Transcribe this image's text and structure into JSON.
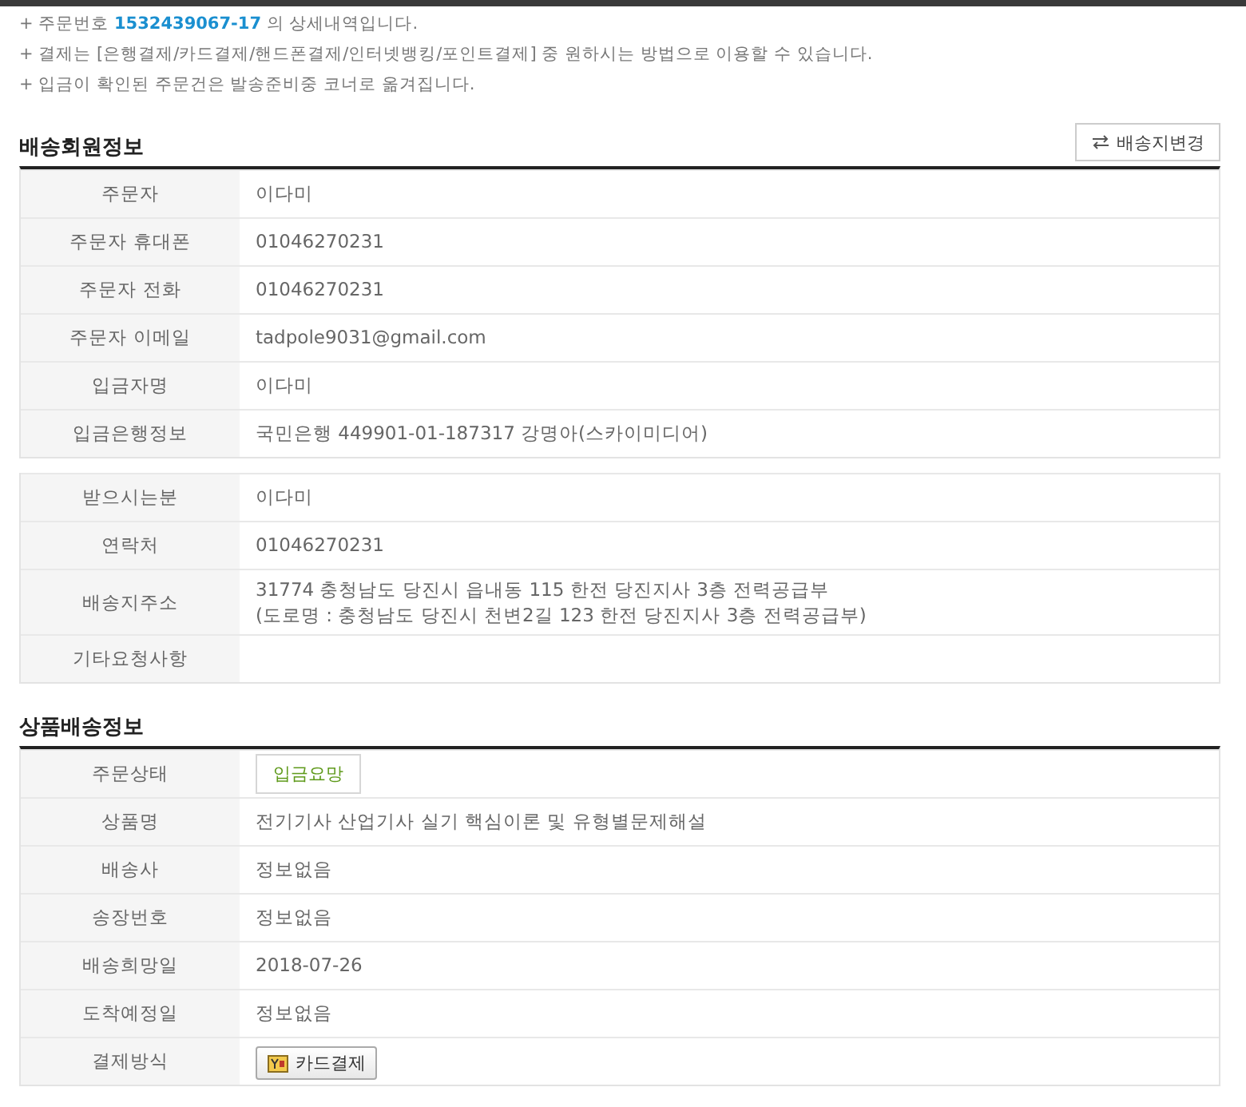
{
  "notes": [
    {
      "text": "+ 주문번호 **1532439067-17** 의 상세내역입니다."
    },
    {
      "text": "+ 결제는 [은행결제/카드결제/핸드폰결제/인터넷뱅킹/포인트결제] 중 원하시는 방법으로 이용할 수 있습니다."
    },
    {
      "text": "+ 입금이 확인된 주문건은 발송준비중 코너로 옮겨집니다."
    }
  ],
  "sections": [
    {
      "title": "배송회원정보",
      "button": {
        "label": "배송지변경"
      },
      "tables": [
        {
          "rows": [
            {
              "kind": "text",
              "label": "주문자",
              "value": "이다미"
            },
            {
              "kind": "text",
              "label": "주문자 휴대폰",
              "value": "01046270231"
            },
            {
              "kind": "text",
              "label": "주문자 전화",
              "value": "01046270231"
            },
            {
              "kind": "text",
              "label": "주문자 이메일",
              "value": "tadpole9031@gmail.com"
            },
            {
              "kind": "text",
              "label": "입금자명",
              "value": "이다미"
            },
            {
              "kind": "text",
              "label": "입금은행정보",
              "value": "국민은행 449901-01-187317 강명아(스카이미디어)"
            }
          ]
        },
        {
          "rows": [
            {
              "kind": "text",
              "label": "받으시는분",
              "value": "이다미"
            },
            {
              "kind": "text",
              "label": "연락처",
              "value": "01046270231"
            },
            {
              "kind": "lines",
              "label": "배송지주소",
              "lines": [
                "31774 충청남도 당진시 읍내동 115 한전 당진지사 3층 전력공급부",
                "(도로명 : 충청남도 당진시 천변2길 123 한전 당진지사 3층 전력공급부)"
              ]
            },
            {
              "kind": "empty",
              "label": "기타요청사항"
            }
          ]
        }
      ]
    },
    {
      "title": "상품배송정보",
      "tables": [
        {
          "rows": [
            {
              "kind": "badge",
              "label": "주문상태",
              "value": "입금요망"
            },
            {
              "kind": "text",
              "label": "상품명",
              "value": "전기기사 산업기사 실기 핵심이론 및 유형별문제해설"
            },
            {
              "kind": "text",
              "label": "배송사",
              "value": "정보없음"
            },
            {
              "kind": "text",
              "label": "송장번호",
              "value": "정보없음"
            },
            {
              "kind": "text",
              "label": "배송희망일",
              "value": "2018-07-26"
            },
            {
              "kind": "text",
              "label": "도착예정일",
              "value": "정보없음"
            },
            {
              "kind": "button",
              "label": "결제방식",
              "value": "카드결제"
            }
          ]
        }
      ]
    }
  ]
}
